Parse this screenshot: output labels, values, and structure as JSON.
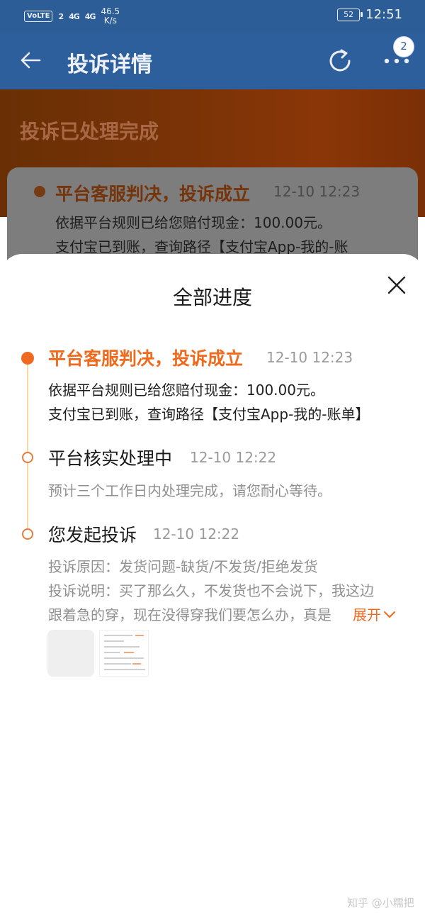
{
  "status_bar": {
    "volte": "VoLTE",
    "sim": "2",
    "signal1": "4G",
    "signal2": "4G",
    "speed_value": "46.5",
    "speed_unit": "K/s",
    "battery": "52",
    "time": "12:51"
  },
  "nav": {
    "back_icon": "back-arrow-icon",
    "title": "投诉详情",
    "refresh_icon": "refresh-icon",
    "more_icon": "more-dots-icon",
    "badge_count": "2"
  },
  "page": {
    "status_title": "投诉已处理完成",
    "latest": {
      "title": "平台客服判决，投诉成立",
      "time": "12-10 12:23",
      "desc1": "依据平台规则已给您赔付现金：100.00元。",
      "desc2": "支付宝已到账，查询路径【支付宝App-我的-账"
    }
  },
  "sheet": {
    "title": "全部进度",
    "close_icon": "close-x-icon",
    "steps": [
      {
        "title": "平台客服判决，投诉成立",
        "time": "12-10 12:23",
        "desc": [
          "依据平台规则已给您赔付现金：100.00元。",
          "支付宝已到账，查询路径【支付宝App-我的-账单】"
        ]
      },
      {
        "title": "平台核实处理中",
        "time": "12-10 12:22",
        "desc": [
          "预计三个工作日内处理完成，请您耐心等待。"
        ]
      },
      {
        "title": "您发起投诉",
        "time": "12-10 12:22",
        "desc": [
          "投诉原因：发货问题-缺货/不发货/拒绝发货",
          "投诉说明：买了那么久，不发货也不会说下，我这边",
          "跟着急的穿，现在没得穿我们要怎么办，真是"
        ],
        "expand_label": "展开"
      }
    ]
  },
  "watermark": "知乎 @小糯把",
  "colors": {
    "accent": "#f06a1d",
    "nav_bg": "#2e5f9d",
    "timeline_line": "#f5d9a7"
  }
}
